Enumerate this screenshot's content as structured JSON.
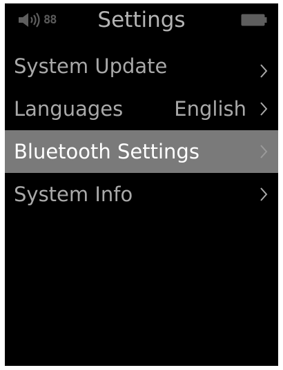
{
  "status_bar": {
    "volume_icon": "speaker-volume-icon",
    "volume_level": "88",
    "title": "Settings",
    "battery_icon": "battery-icon"
  },
  "menu": {
    "items": [
      {
        "label": "System Update",
        "value": "",
        "icon": "chevron-right-icon",
        "selected": false
      },
      {
        "label": "Languages",
        "value": "English",
        "icon": "chevron-right-icon",
        "selected": false
      },
      {
        "label": "Bluetooth Settings",
        "value": "",
        "icon": "chevron-right-icon",
        "selected": true
      },
      {
        "label": "System Info",
        "value": "",
        "icon": "chevron-right-icon",
        "selected": false
      }
    ]
  },
  "colors": {
    "screen_background": "#000000",
    "text": "#a9a9a9",
    "title_text": "#b4b4b4",
    "selected_background": "#7a7a7a",
    "selected_text": "#ffffff",
    "dim_icon": "#5e5e5e"
  }
}
